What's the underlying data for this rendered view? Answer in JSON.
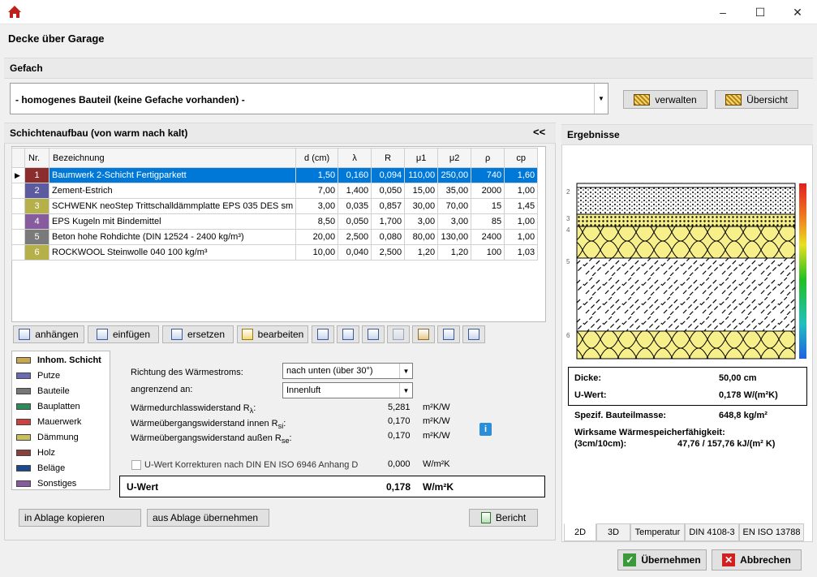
{
  "window": {
    "minimize": "–",
    "maximize": "☐",
    "close": "✕"
  },
  "dialog_title": "Decke über Garage",
  "gefach": {
    "heading": "Gefach",
    "selected": "- homogenes Bauteil (keine Gefache vorhanden) -",
    "verwalten": "verwalten",
    "uebersicht": "Übersicht"
  },
  "schichten": {
    "heading": "Schichtenaufbau (von warm nach kalt)",
    "collapse": "<<",
    "columns": [
      "Nr.",
      "Bezeichnung",
      "d (cm)",
      "λ",
      "R",
      "μ1",
      "μ2",
      "ρ",
      "cp"
    ],
    "rows": [
      {
        "nr": "1",
        "name": "Baumwerk 2-Schicht Fertigparkett",
        "d": "1,50",
        "lambda": "0,160",
        "r": "0,094",
        "mu1": "110,00",
        "mu2": "250,00",
        "rho": "740",
        "cp": "1,60",
        "color": "#8b2d2d"
      },
      {
        "nr": "2",
        "name": "Zement-Estrich",
        "d": "7,00",
        "lambda": "1,400",
        "r": "0,050",
        "mu1": "15,00",
        "mu2": "35,00",
        "rho": "2000",
        "cp": "1,00",
        "color": "#5d5b9f"
      },
      {
        "nr": "3",
        "name": "SCHWENK neoStep Trittschalldämmplatte EPS 035 DES sm",
        "d": "3,00",
        "lambda": "0,035",
        "r": "0,857",
        "mu1": "30,00",
        "mu2": "70,00",
        "rho": "15",
        "cp": "1,45",
        "color": "#b6b04a"
      },
      {
        "nr": "4",
        "name": "EPS Kugeln mit Bindemittel",
        "d": "8,50",
        "lambda": "0,050",
        "r": "1,700",
        "mu1": "3,00",
        "mu2": "3,00",
        "rho": "85",
        "cp": "1,00",
        "color": "#875c9e"
      },
      {
        "nr": "5",
        "name": "Beton hohe Rohdichte  (DIN 12524 - 2400 kg/m³)",
        "d": "20,00",
        "lambda": "2,500",
        "r": "0,080",
        "mu1": "80,00",
        "mu2": "130,00",
        "rho": "2400",
        "cp": "1,00",
        "color": "#7a7a7a"
      },
      {
        "nr": "6",
        "name": "ROCKWOOL Steinwolle 040 100 kg/m³",
        "d": "10,00",
        "lambda": "0,040",
        "r": "2,500",
        "mu1": "1,20",
        "mu2": "1,20",
        "rho": "100",
        "cp": "1,03",
        "color": "#b6b04a"
      }
    ],
    "toolbar": {
      "anhaengen": "anhängen",
      "einfuegen": "einfügen",
      "ersetzen": "ersetzen",
      "bearbeiten": "bearbeiten"
    }
  },
  "legend": [
    {
      "label": "Inhom. Schicht",
      "color": "#c8a84a"
    },
    {
      "label": "Putze",
      "color": "#6a6ab0"
    },
    {
      "label": "Bauteile",
      "color": "#777777"
    },
    {
      "label": "Bauplatten",
      "color": "#2e8b57"
    },
    {
      "label": "Mauerwerk",
      "color": "#d04040"
    },
    {
      "label": "Dämmung",
      "color": "#c8c060"
    },
    {
      "label": "Holz",
      "color": "#8b4040"
    },
    {
      "label": "Beläge",
      "color": "#1a4a8a"
    },
    {
      "label": "Sonstiges",
      "color": "#8a5aa0"
    }
  ],
  "params": {
    "richtung_label": "Richtung des Wärmestroms:",
    "richtung_value": "nach unten (über 30°)",
    "angrenzend_label": "angrenzend an:",
    "angrenzend_value": "Innenluft",
    "r_label": "Wärmedurchlasswiderstand R",
    "r_sub": "λ",
    "r_value": "5,281",
    "r_unit": "m²K/W",
    "rsi_label": "Wärmeübergangswiderstand innen R",
    "rsi_sub": "si",
    "rsi_value": "0,170",
    "rsi_unit": "m²K/W",
    "rse_label": "Wärmeübergangswiderstand außen R",
    "rse_sub": "se",
    "rse_value": "0,170",
    "rse_unit": "m²K/W",
    "korrektur_label": "U-Wert Korrekturen nach DIN EN ISO 6946 Anhang D",
    "korrektur_value": "0,000",
    "korrektur_unit": "W/m²K",
    "uwert_label": "U-Wert",
    "uwert_value": "0,178",
    "uwert_unit": "W/m²K"
  },
  "bottom": {
    "kopieren": "in Ablage kopieren",
    "uebernehmen": "aus Ablage übernehmen",
    "bericht": "Bericht"
  },
  "ergebnisse": {
    "heading": "Ergebnisse",
    "layer_numbers": [
      "2",
      "3",
      "4",
      "5",
      "6"
    ],
    "dicke_label": "Dicke:",
    "dicke_value": "50,00 cm",
    "uwert_label": "U-Wert:",
    "uwert_value": "0,178 W/(m²K)",
    "masse_label": "Spezif. Bauteilmasse:",
    "masse_value": "648,8 kg/m²",
    "speicher_label": "Wirksame Wärmespeicherfähigkeit:",
    "speicher_sub": "(3cm/10cm):",
    "speicher_value": "47,76 / 157,76 kJ/(m² K)",
    "tabs": [
      "2D",
      "3D",
      "Temperatur",
      "DIN 4108-3",
      "EN ISO 13788"
    ]
  },
  "actions": {
    "ok": "Übernehmen",
    "cancel": "Abbrechen"
  }
}
